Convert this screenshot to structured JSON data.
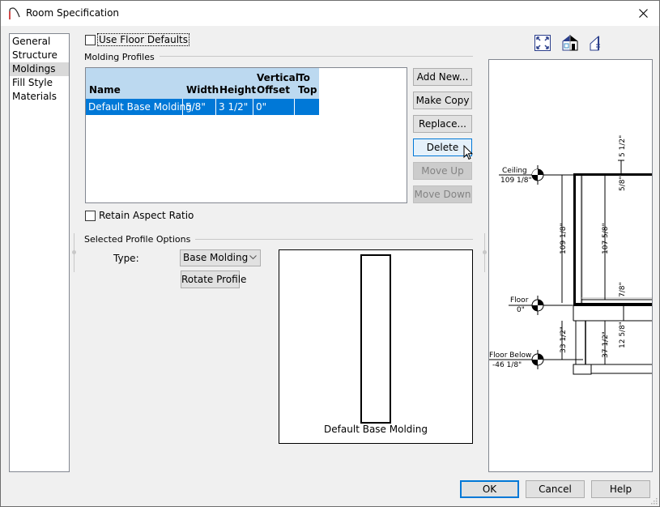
{
  "window": {
    "title": "Room Specification",
    "close_icon": "close-icon",
    "app_icon": "chief-architect-arch-icon"
  },
  "nav": {
    "items": [
      {
        "label": "General",
        "selected": false
      },
      {
        "label": "Structure",
        "selected": false
      },
      {
        "label": "Moldings",
        "selected": true
      },
      {
        "label": "Fill Style",
        "selected": false
      },
      {
        "label": "Materials",
        "selected": false
      }
    ]
  },
  "moldings": {
    "use_floor_defaults_label": "Use Floor Defaults",
    "use_floor_defaults_checked": false,
    "profiles_group_label": "Molding Profiles",
    "table": {
      "columns": [
        {
          "label": "Name"
        },
        {
          "label": "Width"
        },
        {
          "label": "Height"
        },
        {
          "label": "Vertical Offset"
        },
        {
          "label": "To Top"
        }
      ],
      "column_lines": {
        "vertical_offset": [
          "Vertical",
          "Offset"
        ],
        "to_top": [
          "To",
          "Top"
        ]
      },
      "rows": [
        {
          "name": "Default Base Molding",
          "width": "5/8\"",
          "height": "3 1/2\"",
          "vertical_offset": "0\"",
          "to_top": "",
          "selected": true
        }
      ]
    },
    "buttons": {
      "add_new": "Add New...",
      "make_copy": "Make Copy",
      "replace": "Replace...",
      "delete": "Delete",
      "move_up": "Move Up",
      "move_down": "Move Down"
    },
    "retain_aspect_ratio_label": "Retain Aspect Ratio",
    "retain_aspect_ratio_checked": false,
    "selected_profile_group_label": "Selected Profile Options",
    "type_label": "Type:",
    "type_value": "Base Molding",
    "rotate_profile_label": "Rotate Profile",
    "preview_caption": "Default Base Molding"
  },
  "preview_toolbar": {
    "icons": [
      "fit-to-window-icon",
      "exterior-view-icon",
      "section-view-icon"
    ]
  },
  "section_drawing": {
    "labels": {
      "ceiling": "Ceiling",
      "ceiling_elev": "109 1/8\"",
      "floor": "Floor",
      "floor_elev": "0\"",
      "floor_below": "Floor Below",
      "floor_below_elev": "-46 1/8\"",
      "dim_top": "5 1/2\"",
      "dim_ceiling_thick": "5/8\"",
      "dim_total_height": "109 1/8\"",
      "dim_inner_height": "107 5/8\"",
      "dim_floor_finish": "7/8\"",
      "dim_lower_left": "33 1/2\"",
      "dim_lower_inner": "37 1/2\"",
      "dim_floor_struct": "12 5/8\""
    }
  },
  "footer": {
    "ok": "OK",
    "cancel": "Cancel",
    "help": "Help"
  },
  "colors": {
    "selection": "#0078d7",
    "header_bg": "#bcd9f0",
    "accent_red": "#d12b2b"
  }
}
